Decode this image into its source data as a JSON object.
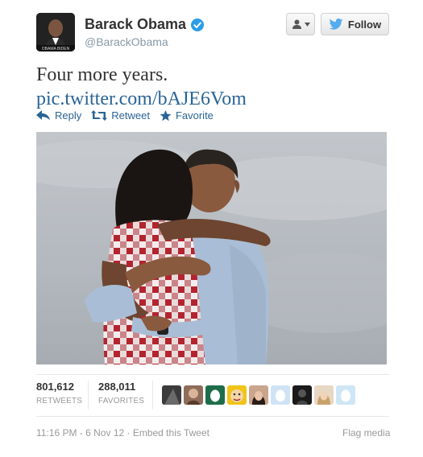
{
  "header": {
    "display_name": "Barack Obama",
    "screen_name": "@BarackObama",
    "follow_label": "Follow",
    "avatar_caption": "OBAMA BIDEN",
    "verified": true
  },
  "tweet": {
    "text": "Four more years.",
    "link": "pic.twitter.com/bAJE6Vom"
  },
  "actions": {
    "reply": "Reply",
    "retweet": "Retweet",
    "favorite": "Favorite"
  },
  "stats": {
    "retweets_count": "801,612",
    "retweets_label": "RETWEETS",
    "favorites_count": "288,011",
    "favorites_label": "FAVORITES"
  },
  "footer": {
    "timestamp_text": "11:16 PM - 6 Nov 12 · Embed this Tweet",
    "flag_media": "Flag media"
  },
  "colors": {
    "link_blue": "#2a6496",
    "twitter_blue": "#55acee",
    "verified_blue": "#2b9ce8",
    "muted_gray": "#999999"
  }
}
